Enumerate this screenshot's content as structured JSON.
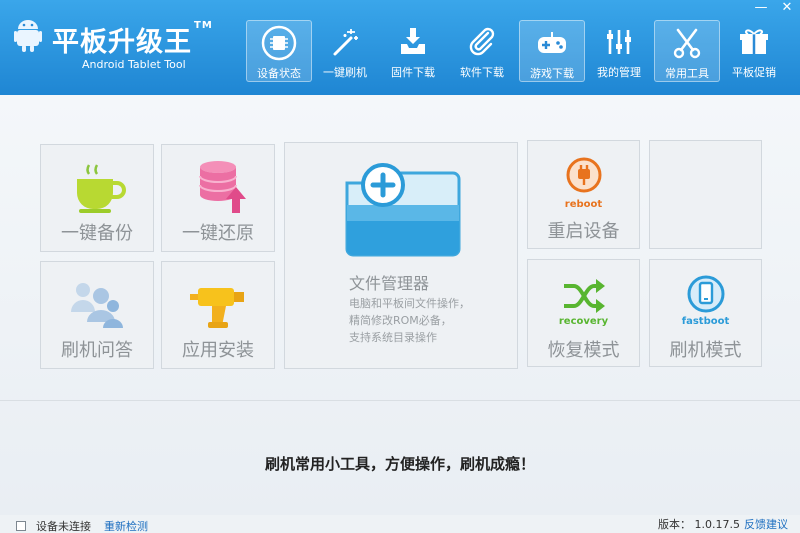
{
  "app": {
    "title": "平板升级王",
    "tm": "TM",
    "subtitle": "Android Tablet Tool"
  },
  "window_controls": {
    "minimize": "—",
    "close": "✕"
  },
  "nav": [
    {
      "label": "设备状态",
      "icon": "device-chip-icon",
      "active": true
    },
    {
      "label": "一键刷机",
      "icon": "magic-wand-icon",
      "active": false
    },
    {
      "label": "固件下载",
      "icon": "download-tray-icon",
      "active": false
    },
    {
      "label": "软件下载",
      "icon": "paperclip-icon",
      "active": false
    },
    {
      "label": "游戏下载",
      "icon": "gamepad-icon",
      "active": true
    },
    {
      "label": "我的管理",
      "icon": "sliders-icon",
      "active": false
    },
    {
      "label": "常用工具",
      "icon": "scissors-icon",
      "active": true
    },
    {
      "label": "平板促销",
      "icon": "gift-icon",
      "active": false
    }
  ],
  "tiles": {
    "backup": "一键备份",
    "restore": "一键还原",
    "faq": "刷机问答",
    "install": "应用安装",
    "file_manager": {
      "title": "文件管理器",
      "desc": [
        "电脑和平板间文件操作，",
        "精简修改ROM必备，",
        "支持系统目录操作"
      ]
    },
    "reboot": {
      "title": "重启设备",
      "badge": "reboot"
    },
    "recovery": {
      "title": "恢复模式",
      "badge": "recovery"
    },
    "fastboot": {
      "title": "刷机模式",
      "badge": "fastboot"
    }
  },
  "slogan": "刷机常用小工具，方便操作，刷机成瘾！",
  "status": {
    "connection": "设备未连接",
    "redetect": "重新检测",
    "version_label": "版本：",
    "version": "1.0.17.5",
    "feedback": "反馈建议"
  },
  "colors": {
    "header_top": "#3aa6ea",
    "header_bottom": "#1f86d3",
    "accent_green": "#58b530",
    "accent_orange": "#e8731e",
    "accent_blue": "#2b9bd8",
    "accent_pink": "#e04b8a"
  }
}
